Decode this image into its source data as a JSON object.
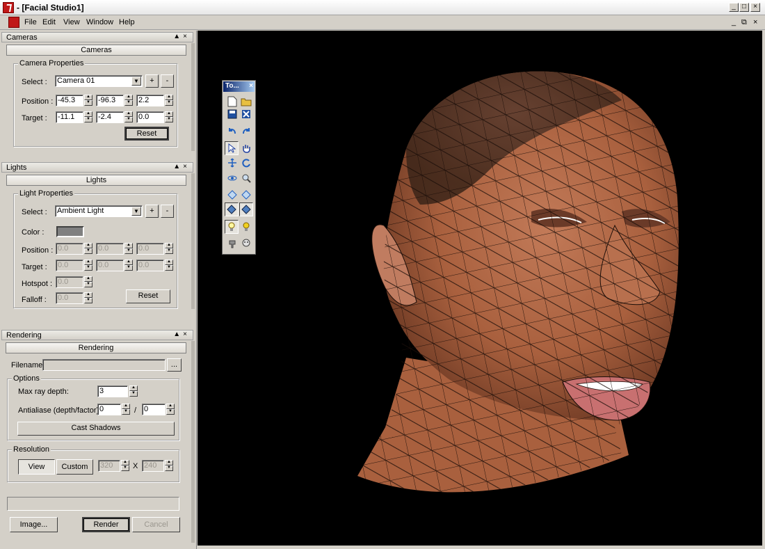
{
  "window": {
    "title": "- [Facial Studio1]",
    "controls": [
      "_",
      "□",
      "×"
    ],
    "mdi_controls": [
      "_",
      "⧉",
      "×"
    ]
  },
  "menu": [
    "File",
    "Edit",
    "View",
    "Window",
    "Help"
  ],
  "cameras": {
    "header": "Cameras",
    "rollup_label": "Cameras",
    "group_title": "Camera Properties",
    "select_label": "Select :",
    "select_value": "Camera 01",
    "add": "+",
    "remove": "-",
    "position_label": "Position :",
    "position": [
      "-45.3",
      "-96.3",
      "2.2"
    ],
    "target_label": "Target :",
    "target": [
      "-11.1",
      "-2.4",
      "0.0"
    ],
    "reset": "Reset"
  },
  "lights": {
    "header": "Lights",
    "rollup_label": "Lights",
    "group_title": "Light Properties",
    "select_label": "Select :",
    "select_value": "Ambient Light",
    "add": "+",
    "remove": "-",
    "color_label": "Color :",
    "color_value": "#808080",
    "position_label": "Position :",
    "position": [
      "0.0",
      "0.0",
      "0.0"
    ],
    "target_label": "Target :",
    "target": [
      "0.0",
      "0.0",
      "0.0"
    ],
    "hotspot_label": "Hotspot :",
    "hotspot": "0.0",
    "falloff_label": "Falloff :",
    "falloff": "0.0",
    "reset": "Reset"
  },
  "rendering": {
    "header": "Rendering",
    "rollup_label": "Rendering",
    "filename_label": "Filename:",
    "filename": "",
    "browse": "...",
    "options_title": "Options",
    "max_ray_label": "Max ray depth:",
    "max_ray": "3",
    "antialias_label": "Antialiase (depth/factor):",
    "antialias_depth": "0",
    "antialias_sep": "/",
    "antialias_factor": "0",
    "cast_shadows": "Cast Shadows",
    "resolution_title": "Resolution",
    "view": "View",
    "custom": "Custom",
    "width": "320",
    "x": "X",
    "height": "240",
    "image": "Image...",
    "render": "Render",
    "cancel": "Cancel"
  },
  "toolbar": {
    "title": "To...",
    "close": "×",
    "icons": [
      "new-file-icon",
      "open-folder-icon",
      "save-icon",
      "close-file-icon",
      "undo-icon",
      "redo-icon",
      "select-arrow-icon",
      "pan-hand-icon",
      "move-icon",
      "rotate-icon",
      "orbit-icon",
      "zoom-icon",
      "mesh-view-icon",
      "mesh-select-icon",
      "solid-mesh-icon",
      "solid-mesh-selected-icon",
      "light-bulb-icon",
      "light-bulb-on-icon",
      "hand-paint-icon",
      "head-icon"
    ]
  },
  "colors": {
    "face_base": "#b06848",
    "wire": "#1a0d08",
    "background": "#000000",
    "panel": "#d4d0c8"
  }
}
